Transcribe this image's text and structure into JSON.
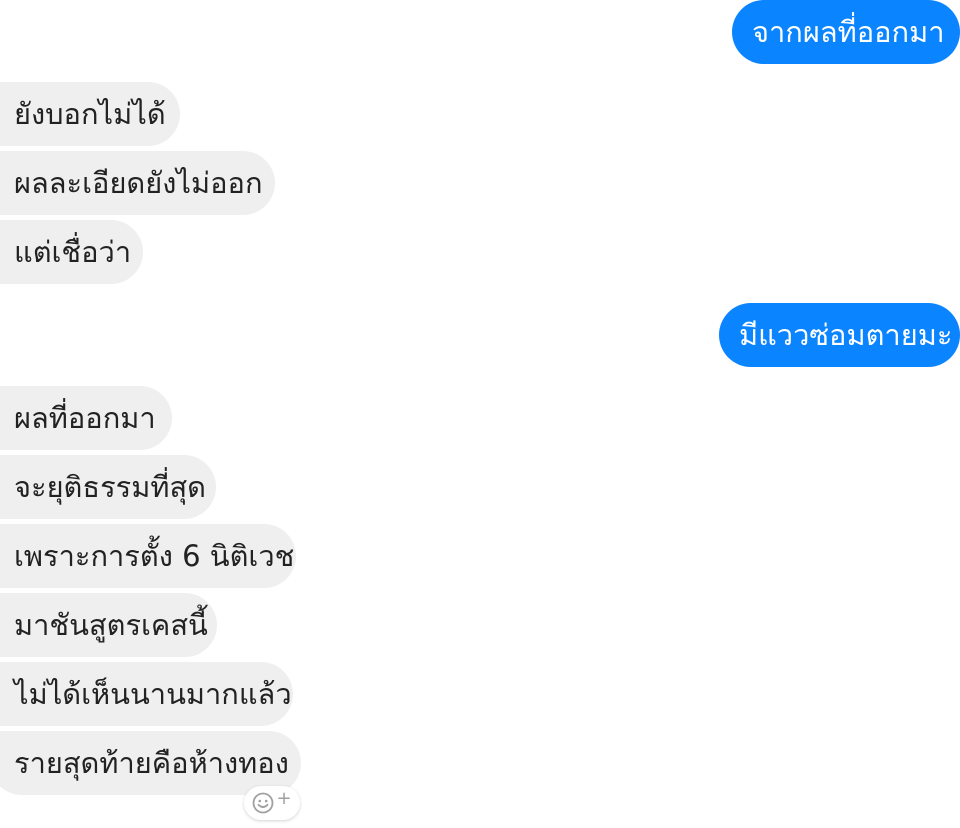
{
  "conversation": {
    "outgoing": [
      {
        "text": "จากผลที่ออกมา"
      },
      {
        "text": "มีแววซ่อมตายมะ"
      }
    ],
    "incoming_group_1": [
      {
        "text": "ยังบอกไม่ได้"
      },
      {
        "text": "ผลละเอียดยังไม่ออก"
      },
      {
        "text": "แต่เชื่อว่า"
      }
    ],
    "incoming_group_2": [
      {
        "text": "ผลที่ออกมา"
      },
      {
        "text": "จะยุติธรรมที่สุด"
      },
      {
        "text": "เพราะการตั้ง 6 นิติเวช"
      },
      {
        "text": "มาชันสูตรเคสนี้"
      },
      {
        "text": "ไม่ได้เห็นนานมากแล้ว"
      },
      {
        "text": "รายสุดท้ายคือห้างทอง"
      }
    ]
  },
  "reaction_button": {
    "icon": "smiley-add-icon",
    "plus": "+"
  },
  "colors": {
    "outgoing_bubble": "#0a84ff",
    "incoming_bubble": "#efefef",
    "background": "#ffffff"
  }
}
